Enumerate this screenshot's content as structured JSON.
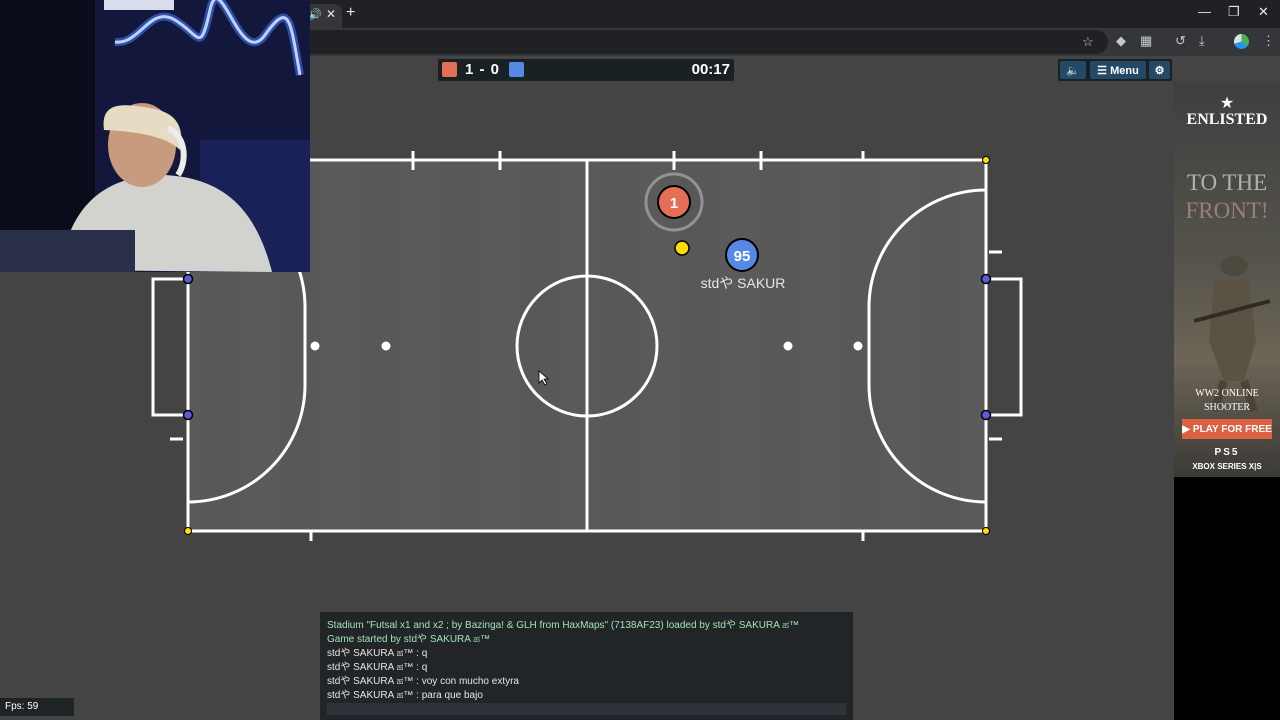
{
  "scoreboard": {
    "red_color": "#e56e56",
    "blue_color": "#5689e5",
    "score": "1 - 0",
    "time": "00:17"
  },
  "controls": {
    "sound_icon": "speaker-icon",
    "menu_label": "☰ Menu",
    "settings_icon": "gear-icon"
  },
  "players": [
    {
      "number": "1",
      "team": "red",
      "color": "#e56e56"
    },
    {
      "number": "95",
      "team": "blue",
      "color": "#5689e5",
      "name": "stdや SAKUR"
    }
  ],
  "ball_color": "#ffdd00",
  "chat": {
    "lines": [
      {
        "type": "system",
        "text": "Stadium \"Futsal x1 and x2 ; by Bazinga! & GLH from HaxMaps\" (7138AF23) loaded by stdや SAKURA ಹ™"
      },
      {
        "type": "system",
        "text": "Game started by stdや SAKURA ಹ™"
      },
      {
        "type": "message",
        "text": "stdや SAKURA ಹ™ : q"
      },
      {
        "type": "message",
        "text": "stdや SAKURA ಹ™ : q"
      },
      {
        "type": "message",
        "text": "stdや SAKURA ಹ™ : voy con mucho extyra"
      },
      {
        "type": "message",
        "text": "stdや SAKURA ಹ™ : para que bajo"
      }
    ],
    "input_value": ""
  },
  "fps": "Fps: 59",
  "ad": {
    "logo": "ENLISTED",
    "headline_1": "TO THE",
    "headline_2": "FRONT!",
    "sub_1": "WW2 ONLINE",
    "sub_2": "SHOOTER",
    "cta": "PLAY FOR FREE",
    "platform_1": "PS5",
    "platform_2": "XBOX SERIES X|S"
  }
}
